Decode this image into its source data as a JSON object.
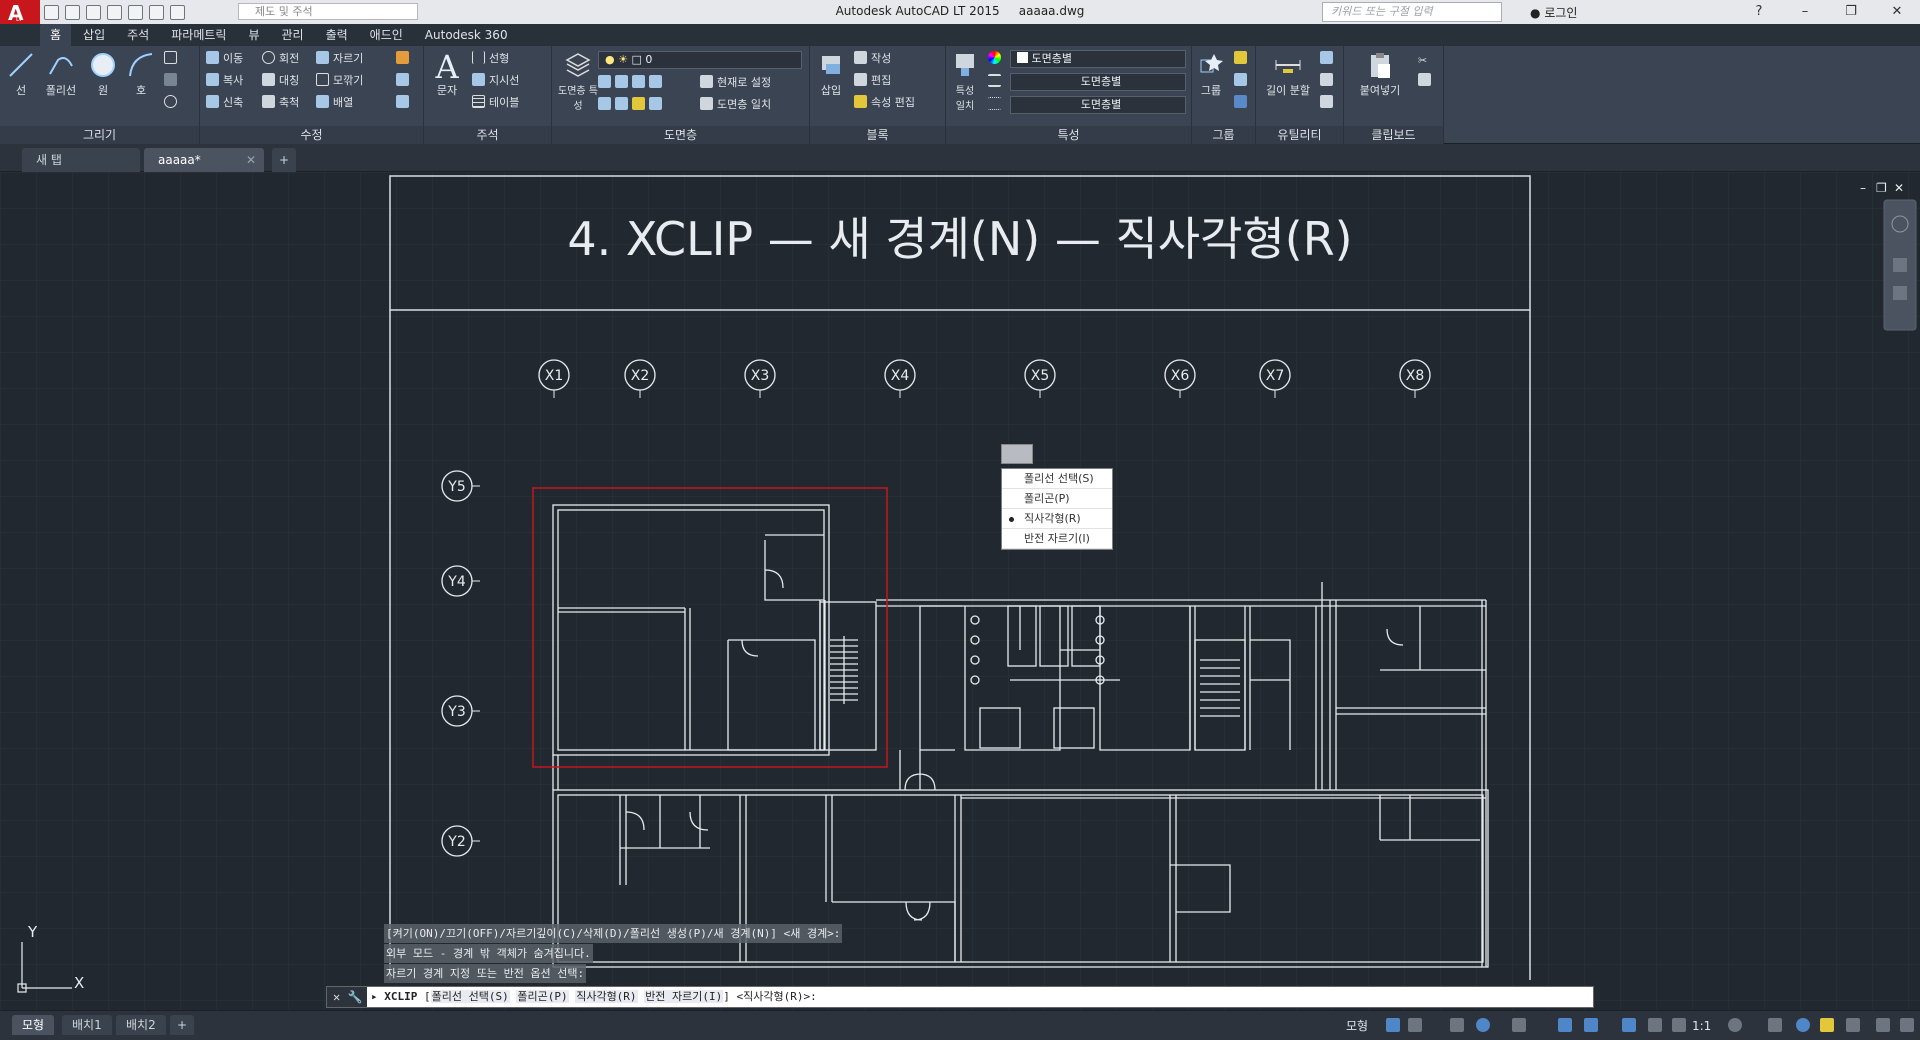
{
  "titlebar": {
    "app_title": "Autodesk AutoCAD LT 2015",
    "file_name": "aaaaa.dwg",
    "workspace": "제도 및 주석",
    "search_placeholder": "키워드 또는 구절 입력",
    "login": "로그인",
    "help": "?"
  },
  "ribbon": {
    "tabs": [
      "홈",
      "삽입",
      "주석",
      "파라메트릭",
      "뷰",
      "관리",
      "출력",
      "애드인",
      "Autodesk 360"
    ],
    "panels": {
      "draw": {
        "label": "그리기",
        "tools": [
          "선",
          "폴리선",
          "원",
          "호"
        ]
      },
      "modify": {
        "label": "수정",
        "tools": [
          "이동",
          "회전",
          "자르기",
          "복사",
          "대칭",
          "모깎기",
          "신축",
          "축척",
          "배열"
        ]
      },
      "annotation": {
        "label": "주석",
        "tools": [
          "문자",
          "선형",
          "지시선",
          "테이블"
        ]
      },
      "layers": {
        "label": "도면층",
        "layer_props": "도면층 특성",
        "current_layer": "0",
        "set_current": "현재로 설정",
        "match": "도면층 일치"
      },
      "block": {
        "label": "블록",
        "insert": "삽입",
        "create": "작성",
        "edit": "편집",
        "attr_edit": "속성 편집"
      },
      "properties": {
        "label": "특성",
        "match": "특성 일치",
        "color": "도면층별",
        "linetype": "도면층별",
        "lineweight": "도면층별"
      },
      "groups": {
        "label": "그룹",
        "group": "그룹"
      },
      "utilities": {
        "label": "유틸리티",
        "measure": "길이 분할"
      },
      "clipboard": {
        "label": "클립보드",
        "paste": "붙여넣기"
      }
    }
  },
  "file_tabs": [
    "새 탭",
    "aaaaa*"
  ],
  "drawing": {
    "title": "4. XCLIP — 새 경계(N) — 직사각형(R)",
    "grid_x": [
      "X1",
      "X2",
      "X3",
      "X4",
      "X5",
      "X6",
      "X7",
      "X8"
    ],
    "grid_y": [
      "Y5",
      "Y4",
      "Y3",
      "Y2"
    ],
    "ucs_x": "X",
    "ucs_y": "Y"
  },
  "context_menu": {
    "items": [
      "폴리선 선택(S)",
      "폴리곤(P)",
      "직사각형(R)",
      "반전 자르기(I)"
    ],
    "selected": "직사각형(R)"
  },
  "command": {
    "history": [
      "[켜기(ON)/끄기(OFF)/자르기깊이(C)/삭제(D)/폴리선 생성(P)/새 경계(N)] <새 경계>:",
      "외부 모드 - 경계 밖 객체가 숨겨집니다.",
      "자르기 경계 지정 또는 반전 옵션 선택:"
    ],
    "name": "XCLIP",
    "options": [
      "폴리선 선택(S)",
      "폴리곤(P)",
      "직사각형(R)",
      "반전 자르기(I)"
    ],
    "default": "<직사각형(R)>:"
  },
  "status": {
    "layout_tabs": [
      "모형",
      "배치1",
      "배치2"
    ],
    "model": "모형",
    "scale": "1:1"
  },
  "colors": {
    "canvas": "#212830",
    "drawing_lines": "#ffffff",
    "clip_rect": "#c8161d",
    "ribbon": "#3b4453"
  }
}
